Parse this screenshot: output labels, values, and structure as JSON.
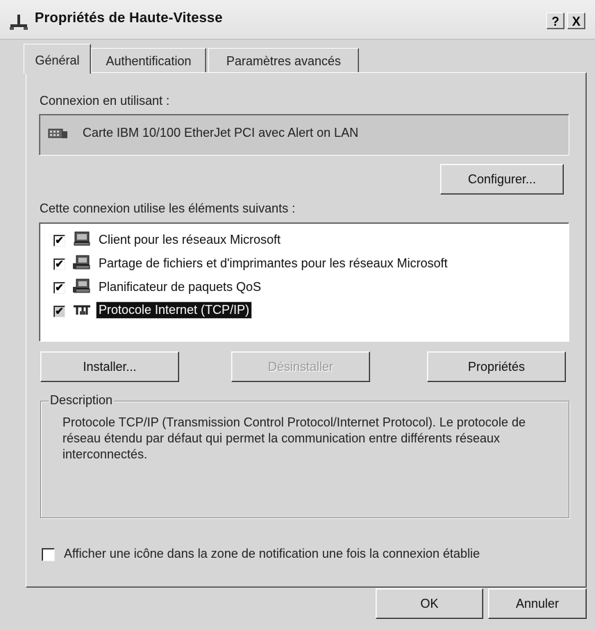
{
  "window": {
    "title": "Propriétés de Haute-Vitesse",
    "help_label": "?",
    "close_label": "X"
  },
  "tabs": [
    {
      "label": "Général",
      "active": true
    },
    {
      "label": "Authentification",
      "active": false
    },
    {
      "label": "Paramètres avancés",
      "active": false
    }
  ],
  "connection": {
    "label": "Connexion en utilisant :",
    "adapter": "Carte IBM 10/100 EtherJet PCI avec Alert on LAN",
    "configure_button": "Configurer..."
  },
  "components": {
    "label": "Cette connexion utilise les éléments suivants :",
    "items": [
      {
        "label": "Client pour les réseaux Microsoft",
        "checked": true,
        "icon": "network-client-icon"
      },
      {
        "label": "Partage de fichiers et d'imprimantes pour les réseaux Microsoft",
        "checked": true,
        "icon": "network-service-icon"
      },
      {
        "label": "Planificateur de paquets QoS",
        "checked": true,
        "icon": "network-service-icon"
      },
      {
        "label": "Protocole Internet (TCP/IP)",
        "checked": true,
        "selected": true,
        "icon": "network-protocol-icon"
      }
    ],
    "install_button": "Installer...",
    "uninstall_button": "Désinstaller",
    "properties_button": "Propriétés"
  },
  "description": {
    "legend": "Description",
    "text": "Protocole TCP/IP (Transmission Control Protocol/Internet Protocol). Le protocole de réseau étendu par défaut qui permet la communication entre différents réseaux interconnectés."
  },
  "notify": {
    "label": "Afficher une icône dans la zone de notification une fois la connexion établie",
    "checked": false
  },
  "footer": {
    "ok_button": "OK",
    "cancel_button": "Annuler"
  }
}
